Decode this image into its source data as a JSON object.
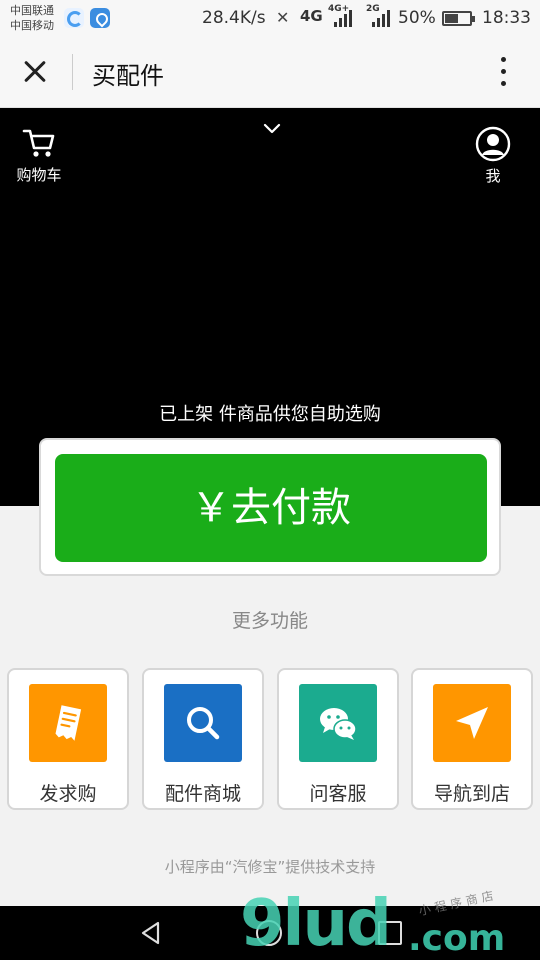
{
  "status_bar": {
    "carriers": [
      "中国联通",
      "中国移动"
    ],
    "speed": "28.4K/s",
    "network_1": "4G",
    "network_2": "4G+",
    "network_3": "2G",
    "battery_percent": "50%",
    "battery_level": 0.5,
    "time": "18:33"
  },
  "header": {
    "title": "买配件"
  },
  "banner": {
    "cart_label": "购物车",
    "me_label": "我",
    "info_text": "已上架 件商品供您自助选购"
  },
  "pay": {
    "label": "￥去付款",
    "color": "#1aad19"
  },
  "more": {
    "title": "更多功能",
    "tiles": [
      {
        "label": "发求购",
        "icon": "receipt-icon",
        "color": "#ff9600"
      },
      {
        "label": "配件商城",
        "icon": "search-icon",
        "color": "#1a6fc4"
      },
      {
        "label": "问客服",
        "icon": "wechat-chat-icon",
        "color": "#1bab8f"
      },
      {
        "label": "导航到店",
        "icon": "navigation-arrow-icon",
        "color": "#ff9600"
      }
    ]
  },
  "footer": {
    "text": "小程序由“汽修宝”提供技术支持"
  },
  "watermark": {
    "main": "9lud",
    "domain": ".com",
    "small": "小程序商店"
  }
}
